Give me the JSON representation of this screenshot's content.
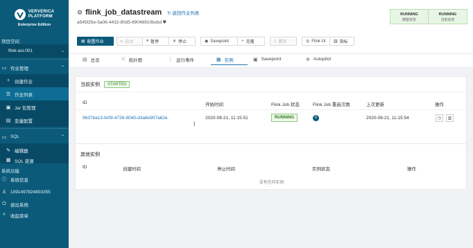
{
  "brand": {
    "name_line1": "VERVERICA",
    "name_line2": "PLATFORM",
    "edition": "Enterprise Edition"
  },
  "sidebar": {
    "project_section": "项目空间",
    "project_name": "flink-asi-001",
    "job_management": "作业管理",
    "items": [
      {
        "label": "创建作业",
        "icon": "plus-icon"
      },
      {
        "label": "作业列表",
        "icon": "list-icon"
      },
      {
        "label": "Jar 包管理",
        "icon": "jar-icon"
      },
      {
        "label": "变量配置",
        "icon": "variable-icon"
      }
    ],
    "sql_section": "SQL",
    "sql_items": [
      {
        "label": "编辑器",
        "icon": "editor-icon"
      },
      {
        "label": "SQL 资源",
        "icon": "sql-icon"
      }
    ],
    "system_section": "系统功能",
    "system_items": [
      {
        "label": "系统信息",
        "icon": "info-icon"
      },
      {
        "label": "1091497824803355",
        "icon": "user-icon"
      },
      {
        "label": "退出系统",
        "icon": "logout-icon"
      },
      {
        "label": "收起菜单",
        "icon": "collapse-icon"
      }
    ]
  },
  "header": {
    "title": "flink_job_datastream",
    "back_link": "返回作业列表",
    "job_id": "a545f25e-5a06-4432-80d5-69048910bcbd",
    "status": [
      {
        "state": "RUNNING",
        "label": "期望状态"
      },
      {
        "state": "RUNNING",
        "label": "当前状态"
      }
    ]
  },
  "toolbar": {
    "configure": "配置作业",
    "start": "启动",
    "pause": "暂停",
    "stop": "停止",
    "savepoint": "Savepoint",
    "clone": "克隆",
    "delete": "删除",
    "flink_ui": "Flink UI",
    "metrics": "指标"
  },
  "tabs": [
    {
      "label": "总览",
      "icon": "overview-icon"
    },
    {
      "label": "拓扑图",
      "icon": "topology-icon"
    },
    {
      "label": "运行事件",
      "icon": "events-icon"
    },
    {
      "label": "实例",
      "icon": "instance-icon"
    },
    {
      "label": "Savepoint",
      "icon": "savepoint-icon"
    },
    {
      "label": "Autopilot",
      "icon": "autopilot-icon"
    }
  ],
  "current_instance": {
    "title": "当前实例",
    "badge": "STARTED",
    "columns": [
      "ID",
      "开始时间",
      "Flink Job 状态",
      "Flink Job 重启次数",
      "上次更新",
      "操作"
    ],
    "row": {
      "id": "9637ba13-fe09-4726-8040-d3a8e907a62e",
      "start_time": "2020-08-21, 11:15:51",
      "status": "RUNNING",
      "restarts": "0",
      "last_update": "2020-08-21, 11:15:54"
    }
  },
  "other_instances": {
    "title": "其他实例",
    "columns": [
      "ID",
      "创建时间",
      "停止时间",
      "实例状态",
      "操作"
    ],
    "empty_text": "没有任何实例"
  },
  "colors": {
    "sidebar": "#0b5a7a",
    "accent": "#1a6fb0",
    "running": "#2d7a20"
  }
}
